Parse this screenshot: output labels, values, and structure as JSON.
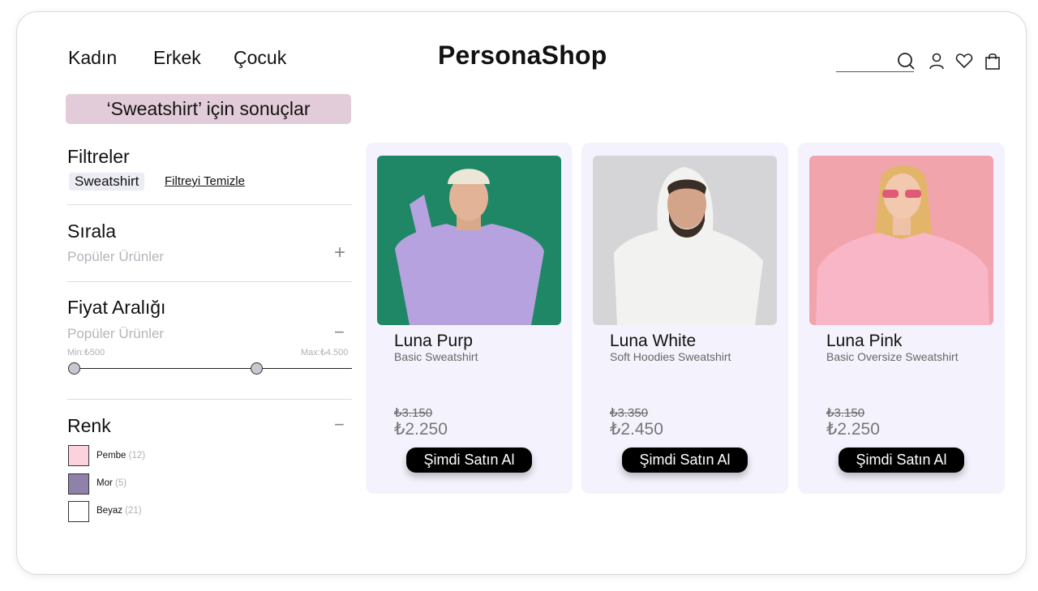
{
  "header": {
    "nav": [
      "Kadın",
      "Erkek",
      "Çocuk"
    ],
    "logo": "PersonaShop",
    "icons": [
      "search-icon",
      "user-icon",
      "heart-icon",
      "bag-icon"
    ]
  },
  "results_banner": "‘Sweatshirt’ için sonuçlar",
  "filters": {
    "title": "Filtreler",
    "active_chip": "Sweatshirt",
    "clear_label": "Filtreyi Temizle"
  },
  "sort": {
    "title": "Sırala",
    "value": "Popüler Ürünler",
    "toggle": "+"
  },
  "price_range": {
    "title": "Fiyat Aralığı",
    "value": "Popüler Ürünler",
    "toggle": "−",
    "min_label": "Min:₺500",
    "max_label": "Max:₺4.500"
  },
  "color": {
    "title": "Renk",
    "toggle": "−",
    "options": [
      {
        "name": "Pembe",
        "count": "(12)",
        "color": "#fcd2dd"
      },
      {
        "name": "Mor",
        "count": "(5)",
        "color": "#8f81aa"
      },
      {
        "name": "Beyaz",
        "count": "(21)",
        "color": "#ffffff"
      }
    ]
  },
  "products": [
    {
      "name": "Luna Purp",
      "subtitle": "Basic Sweatshirt",
      "old_price": "₺3.150",
      "price": "₺2.250",
      "button": "Şimdi Satın Al",
      "bg": "#1f8766",
      "garment": "#b6a2de"
    },
    {
      "name": "Luna White",
      "subtitle": "Soft Hoodies Sweatshirt",
      "old_price": "₺3.350",
      "price": "₺2.450",
      "button": "Şimdi Satın Al",
      "bg": "#d5d5d8",
      "garment": "#f2f2f0"
    },
    {
      "name": "Luna Pink",
      "subtitle": "Basic Oversize Sweatshirt",
      "old_price": "₺3.150",
      "price": "₺2.250",
      "button": "Şimdi Satın Al",
      "bg": "#f2a4ad",
      "garment": "#f8b6c7"
    }
  ]
}
